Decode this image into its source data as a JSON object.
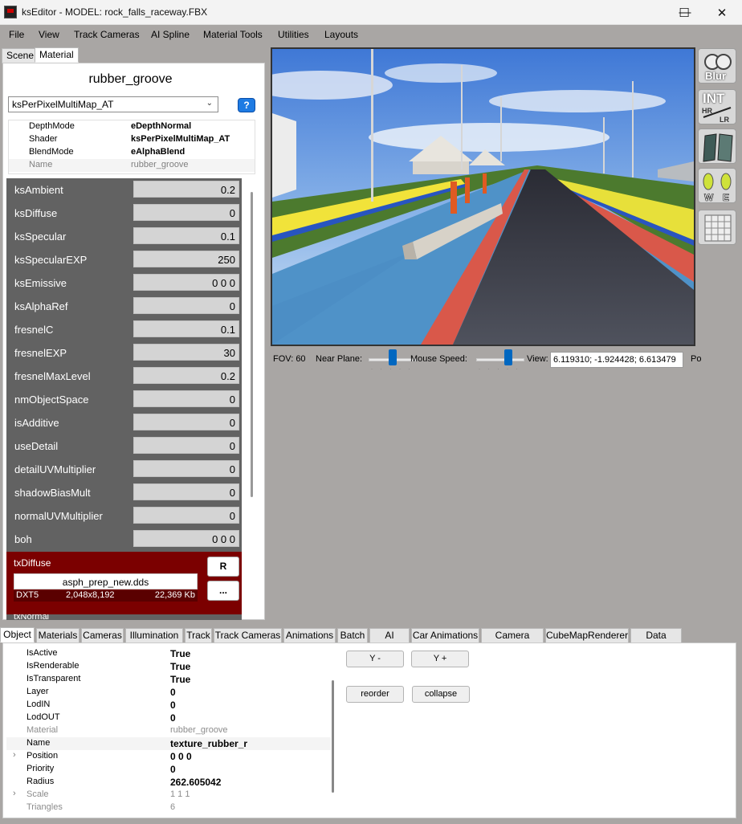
{
  "window": {
    "title": "ksEditor - MODEL: rock_falls_raceway.FBX",
    "minimize": "—",
    "maximize": "☐",
    "close": "✕"
  },
  "menu": [
    "File",
    "View",
    "Track Cameras",
    "AI Spline",
    "Material Tools",
    "Utilities",
    "Layouts"
  ],
  "top_tabs": [
    "Scene",
    "Material"
  ],
  "material": {
    "name": "rubber_groove",
    "shader_select": "ksPerPixelMultiMap_AT",
    "help_label": "?",
    "properties": [
      {
        "key": "DepthMode",
        "value": "eDepthNormal"
      },
      {
        "key": "Shader",
        "value": "ksPerPixelMultiMap_AT"
      },
      {
        "key": "BlendMode",
        "value": "eAlphaBlend"
      },
      {
        "key": "Name",
        "value": "rubber_groove"
      }
    ],
    "params": [
      {
        "label": "ksAmbient",
        "value": "0.2"
      },
      {
        "label": "ksDiffuse",
        "value": "0"
      },
      {
        "label": "ksSpecular",
        "value": "0.1"
      },
      {
        "label": "ksSpecularEXP",
        "value": "250"
      },
      {
        "label": "ksEmissive",
        "value": "0 0 0"
      },
      {
        "label": "ksAlphaRef",
        "value": "0"
      },
      {
        "label": "fresnelC",
        "value": "0.1"
      },
      {
        "label": "fresnelEXP",
        "value": "30"
      },
      {
        "label": "fresnelMaxLevel",
        "value": "0.2"
      },
      {
        "label": "nmObjectSpace",
        "value": "0"
      },
      {
        "label": "isAdditive",
        "value": "0"
      },
      {
        "label": "useDetail",
        "value": "0"
      },
      {
        "label": "detailUVMultiplier",
        "value": "0"
      },
      {
        "label": "shadowBiasMult",
        "value": "0"
      },
      {
        "label": "normalUVMultiplier",
        "value": "0"
      },
      {
        "label": "boh",
        "value": "0 0 0"
      }
    ],
    "texture": {
      "slot": "txDiffuse",
      "file": "asph_prep_new.dds",
      "format": "DXT5",
      "dims": "2,048x8,192",
      "size": "22,369 Kb",
      "reload_label": "R",
      "browse_label": "...",
      "next_slot": "txNormal"
    }
  },
  "viewport_controls": {
    "fov": "FOV: 60",
    "near_plane": "Near Plane:",
    "mouse_speed": "Mouse Speed:",
    "view_label": "View:",
    "view_value": "6.119310; -1.924428; 6.613479",
    "pos_cut": "Po"
  },
  "toolbar": [
    {
      "icon": "blur-icon",
      "label": "Blur"
    },
    {
      "icon": "int-hr-lr-icon",
      "label": "INT"
    },
    {
      "icon": "glass-panels-icon",
      "label": ""
    },
    {
      "icon": "wheel-west-east-icon",
      "label": "W E"
    },
    {
      "icon": "grid-icon",
      "label": ""
    }
  ],
  "bottom_tabs": [
    "Object",
    "Materials",
    "Cameras",
    "Illumination",
    "Track",
    "Track Cameras",
    "Animations",
    "Batch",
    "AI",
    "Car Animations",
    "Camera Spline",
    "CubeMapRenderer",
    "Data Scripts"
  ],
  "object": {
    "properties": [
      {
        "key": "IsActive",
        "value": "True"
      },
      {
        "key": "IsRenderable",
        "value": "True"
      },
      {
        "key": "IsTransparent",
        "value": "True"
      },
      {
        "key": "Layer",
        "value": "0"
      },
      {
        "key": "LodIN",
        "value": "0"
      },
      {
        "key": "LodOUT",
        "value": "0"
      },
      {
        "key": "Material",
        "value": "rubber_groove"
      },
      {
        "key": "Name",
        "value": "texture_rubber_r"
      },
      {
        "key": "Position",
        "value": "0 0 0"
      },
      {
        "key": "Priority",
        "value": "0"
      },
      {
        "key": "Radius",
        "value": "262.605042"
      },
      {
        "key": "Scale",
        "value": "1 1 1"
      },
      {
        "key": "Triangles",
        "value": "6"
      }
    ],
    "buttons": {
      "y_minus": "Y -",
      "y_plus": "Y +",
      "reorder": "reorder",
      "collapse": "collapse"
    }
  }
}
